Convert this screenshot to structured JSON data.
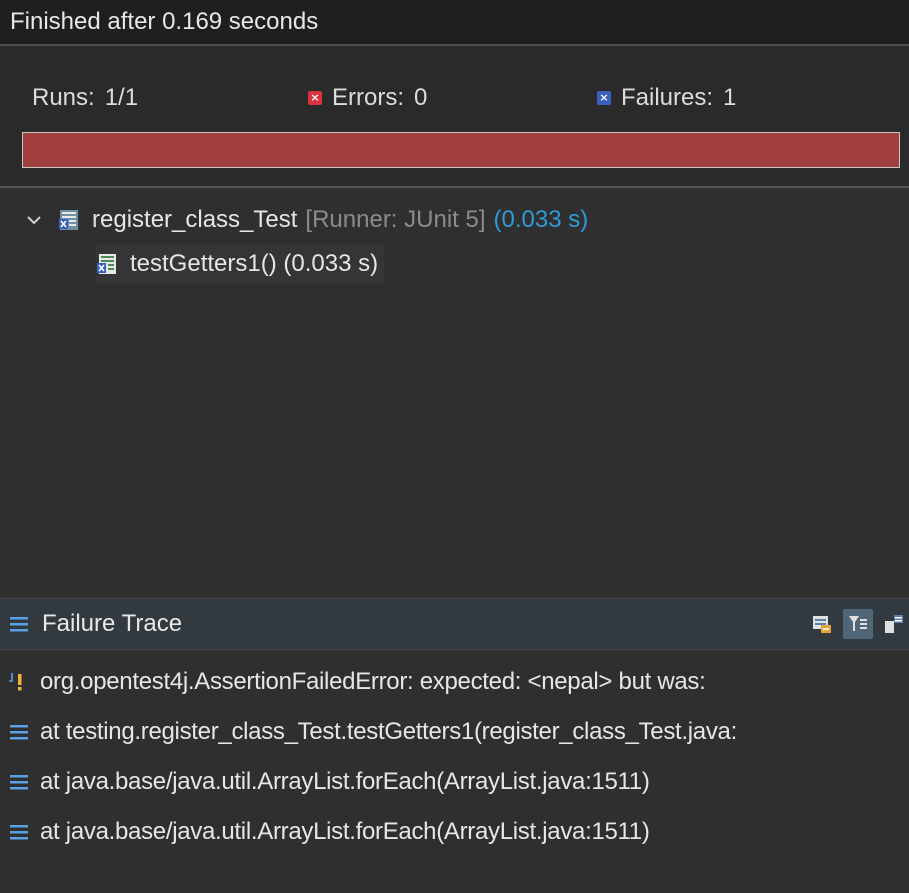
{
  "status": {
    "text": "Finished after 0.169 seconds"
  },
  "counters": {
    "runs_label": "Runs:",
    "runs_value": "1/1",
    "errors_label": "Errors:",
    "errors_value": "0",
    "failures_label": "Failures:",
    "failures_value": "1",
    "error_icon": "error-icon",
    "failure_icon": "failure-icon"
  },
  "progress": {
    "fraction": 1.0,
    "state": "failed",
    "color": "#a13e3e"
  },
  "tree": {
    "class_node": {
      "icon": "test-suite-failed-icon",
      "name": "register_class_Test",
      "runner": "[Runner: JUnit 5]",
      "time": "(0.033 s)"
    },
    "method_node": {
      "icon": "test-failed-icon",
      "name": "testGetters1() (0.033 s)"
    }
  },
  "trace": {
    "title": "Failure Trace",
    "title_icon": "list-icon",
    "tools": [
      "compare-results-icon",
      "filter-trace-icon",
      "copy-trace-icon"
    ],
    "lines": [
      {
        "icon": "assertion-failure-icon",
        "text": "org.opentest4j.AssertionFailedError: expected: <nepal> but was:"
      },
      {
        "icon": "stack-frame-icon",
        "text": "at testing.register_class_Test.testGetters1(register_class_Test.java:"
      },
      {
        "icon": "stack-frame-icon",
        "text": "at java.base/java.util.ArrayList.forEach(ArrayList.java:1511)"
      },
      {
        "icon": "stack-frame-icon",
        "text": "at java.base/java.util.ArrayList.forEach(ArrayList.java:1511)"
      }
    ]
  },
  "colors": {
    "accent_blue": "#2d9bd6",
    "error_red": "#d9333f",
    "failure_blue": "#3b5fbd"
  }
}
